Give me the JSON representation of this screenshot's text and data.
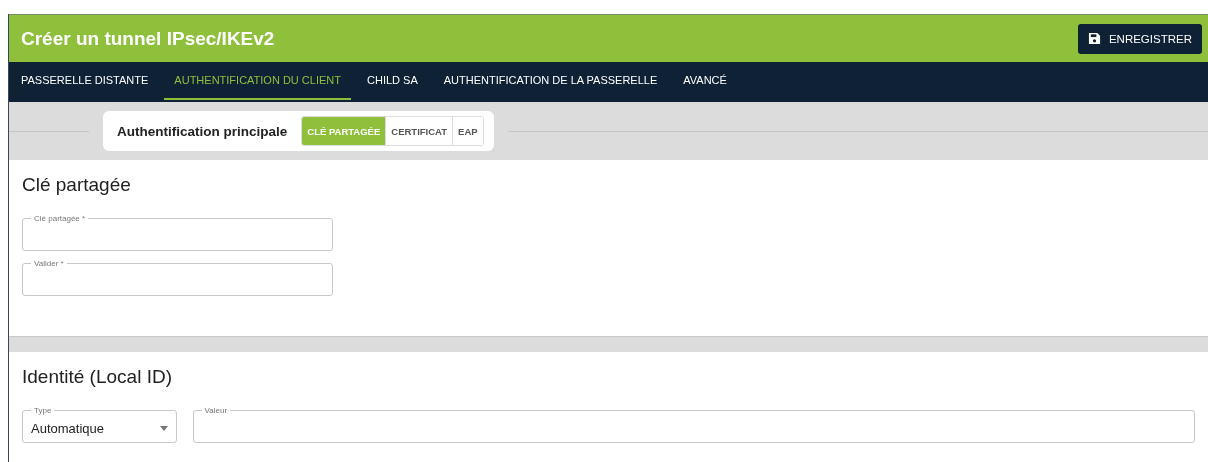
{
  "header": {
    "title": "Créer un tunnel IPsec/IKEv2",
    "save_button": "ENREGISTRER"
  },
  "tabs": [
    {
      "label": "PASSERELLE DISTANTE",
      "selected": false
    },
    {
      "label": "AUTHENTIFICATION DU CLIENT",
      "selected": true
    },
    {
      "label": "CHILD SA",
      "selected": false
    },
    {
      "label": "AUTHENTIFICATION DE LA PASSERELLE",
      "selected": false
    },
    {
      "label": "AVANCÉ",
      "selected": false
    }
  ],
  "auth": {
    "label": "Authentification principale",
    "options": [
      {
        "label": "CLÉ PARTAGÉE",
        "selected": true
      },
      {
        "label": "CERTIFICAT",
        "selected": false
      },
      {
        "label": "EAP",
        "selected": false
      }
    ]
  },
  "shared_key": {
    "title": "Clé partagée",
    "fields": [
      {
        "label": "Clé partagée *"
      },
      {
        "label": "Valider *"
      }
    ]
  },
  "identity": {
    "title": "Identité (Local ID)",
    "type": {
      "label": "Type",
      "value": "Automatique"
    },
    "value_field": {
      "label": "Valeur"
    }
  }
}
